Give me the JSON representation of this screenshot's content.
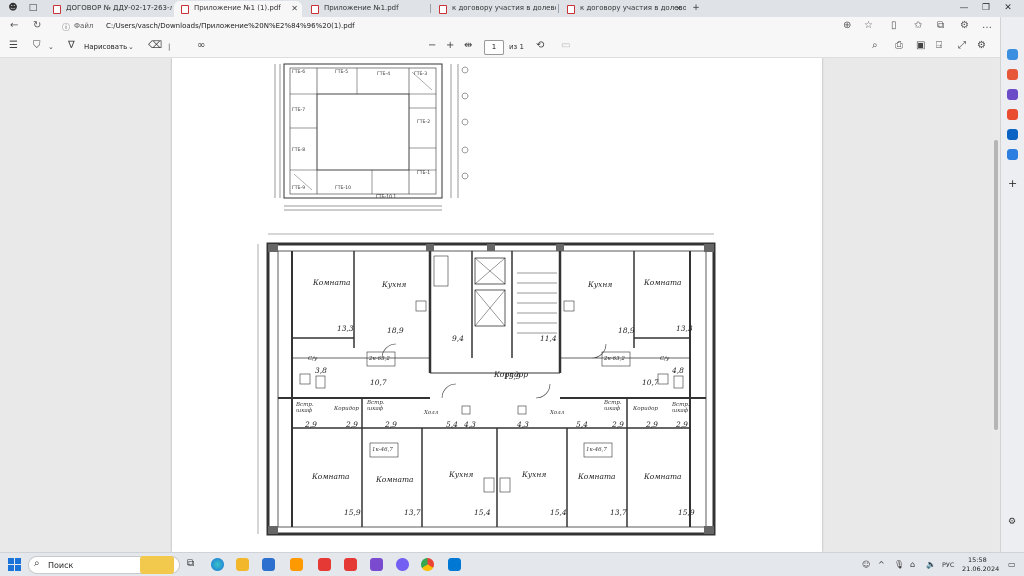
{
  "tabs": [
    {
      "label": "ДОГОВОР № ДДУ-02-17-263-л",
      "active": false
    },
    {
      "label": "Приложение №1 (1).pdf",
      "active": true
    },
    {
      "label": "Приложение №1.pdf",
      "active": false
    },
    {
      "label": "к договору участия в долевом",
      "active": false
    },
    {
      "label": "к договору участия в долевом",
      "active": false
    }
  ],
  "address": {
    "file_label": "Файл",
    "url": "C:/Users/vasch/Downloads/Приложение%20N%E2%84%96%20(1).pdf"
  },
  "pdf_toolbar": {
    "draw_label": "Нарисовать",
    "page_number": "1",
    "page_of": "из 1"
  },
  "plan": {
    "gtb_labels": [
      "ГТБ-6",
      "ГТБ-5",
      "ГТБ-4",
      "ГТБ-3",
      "ГТБ-7",
      "ГТБ-2",
      "ГТБ-8",
      "ГТБ-1",
      "ГТБ-9",
      "ГТБ-10",
      "ГТБ-10.1"
    ],
    "rooms": [
      {
        "name": "Комната",
        "area": "13,3"
      },
      {
        "name": "Кухня",
        "area": "18,9"
      },
      {
        "name": "Кухня",
        "area": "18,9"
      },
      {
        "name": "Комната",
        "area": "13,3"
      },
      {
        "name": "Коридор",
        "area": "15,9"
      },
      {
        "name": "Комната",
        "area": "15,9"
      },
      {
        "name": "Комната",
        "area": "13,7"
      },
      {
        "name": "Кухня",
        "area": "15,4"
      },
      {
        "name": "Кухня",
        "area": "15,4"
      },
      {
        "name": "Комната",
        "area": "13,7"
      },
      {
        "name": "Комната",
        "area": "15,9"
      }
    ],
    "small_areas": [
      "3,8",
      "10,7",
      "9,4",
      "11,4",
      "10,7",
      "4,8",
      "2,9",
      "2,9",
      "2,9",
      "5,4",
      "4,3",
      "4,3",
      "5,4",
      "2,9",
      "2,9",
      "2,9"
    ],
    "small_labels": [
      "С/у",
      "С/у",
      "Встр. шкаф",
      "Коридор",
      "Встр. шкаф",
      "С/у",
      "С/у",
      "Встр. шкаф",
      "Коридор",
      "Встр. шкаф",
      "Холл",
      "Холл"
    ],
    "apt_tags": [
      "2к-63,2",
      "2к-63,2",
      "1к-46,7",
      "1к-46,7"
    ]
  },
  "taskbar": {
    "search_label": "Поиск",
    "lang": "РУС",
    "time": "15:58",
    "date": "21.06.2024"
  }
}
